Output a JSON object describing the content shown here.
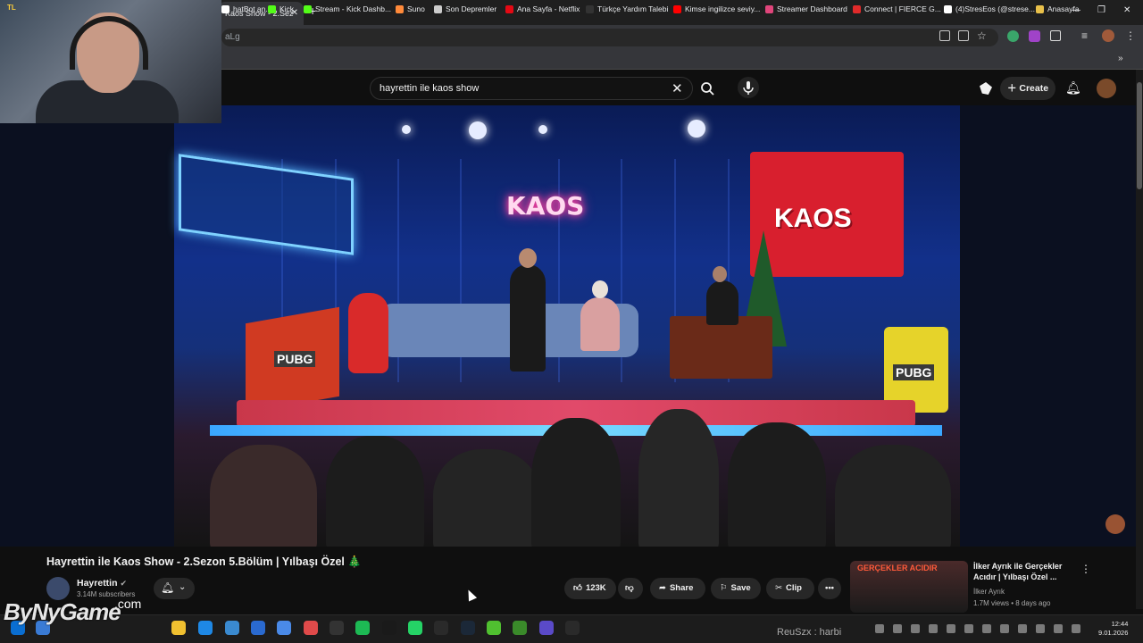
{
  "browser": {
    "tab_title": "Kaos Show - 2.Sez",
    "url_text": "aLg",
    "bookmarks": [
      {
        "label": "hatBot an...",
        "color": "#ffffff"
      },
      {
        "label": "Kick",
        "color": "#53fc18"
      },
      {
        "label": "Stream - Kick Dashb...",
        "color": "#53fc18"
      },
      {
        "label": "Suno",
        "color": "#ff8a3a"
      },
      {
        "label": "Son Depremler",
        "color": "#cccccc"
      },
      {
        "label": "Ana Sayfa - Netflix",
        "color": "#e50914"
      },
      {
        "label": "Türkçe Yardım Talebi",
        "color": "#333333"
      },
      {
        "label": "Kimse ingilizce seviy...",
        "color": "#ff0000"
      },
      {
        "label": "Streamer Dashboard",
        "color": "#e0457b"
      },
      {
        "label": "Connect | FIERCE G...",
        "color": "#e02a2a"
      },
      {
        "label": "(4)StresEos (@strese...",
        "color": "#ffffff"
      },
      {
        "label": "Anasayfa",
        "color": "#e8c04a"
      }
    ]
  },
  "youtube": {
    "search_value": "hayrettin ile kaos show",
    "create_label": "Create",
    "video_title": "Hayrettin ile Kaos Show - 2.Sezon 5.Bölüm | Yılbaşı Özel 🎄",
    "channel_name": "Hayrettin",
    "subscribers": "3.14M subscribers",
    "like_count": "123K",
    "share_label": "Share",
    "save_label": "Save",
    "clip_label": "Clip",
    "scene": {
      "neon_sign": "KAOS",
      "right_sign": "KAOS",
      "pubg_label": "PUBG"
    },
    "recommended": {
      "thumb_caption": "GERÇEKLER ACIDIR",
      "title": "İlker Ayrık ile Gerçekler Acıdır | Yılbaşı Özel ...",
      "channel": "İlker Ayrık",
      "meta": "1.7M views • 8 days ago"
    }
  },
  "overlay": {
    "watermark": "ByNyGame",
    "watermark_suffix": ".com",
    "overlay_text": "ReuSzx : harbi",
    "webcam_tag": "TL"
  },
  "taskbar": {
    "time": "12:44",
    "date": "9.01.2026"
  },
  "colors": {
    "background": "#0f0f0f",
    "accent_red": "#ff0000",
    "chip": "#272727"
  }
}
